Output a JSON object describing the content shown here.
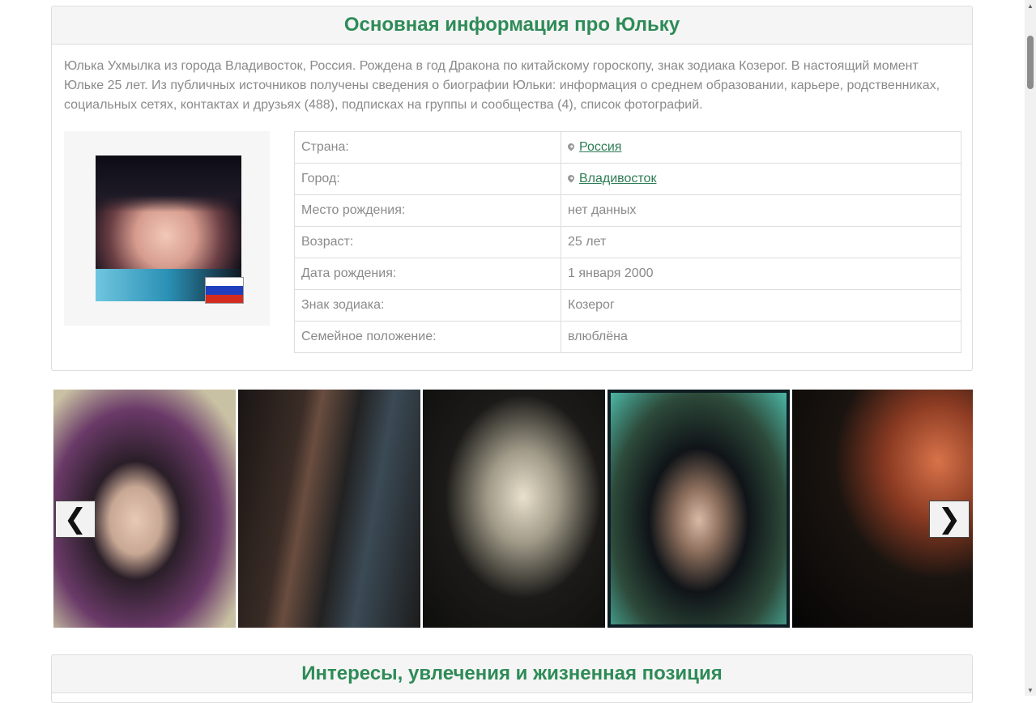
{
  "main_panel": {
    "title": "Основная информация про Юльку",
    "intro": "Юлька Ухмылка из города Владивосток, Россия. Рождена в год Дракона по китайскому гороскопу, знак зодиака Козерог. В настоящий момент Юльке 25 лет. Из публичных источников получены сведения о биографии Юльки: информация о среднем образовании, карьере, родственниках, социальных сетях, контактах и друзьях (488), подписках на группы и сообщества (4), список фотографий.",
    "info_rows": [
      {
        "label": "Страна:",
        "value": "Россия",
        "link": true
      },
      {
        "label": "Город:",
        "value": "Владивосток",
        "link": true
      },
      {
        "label": "Место рождения:",
        "value": "нет данных"
      },
      {
        "label": "Возраст:",
        "value": "25 лет"
      },
      {
        "label": "Дата рождения:",
        "value": "1 января 2000"
      },
      {
        "label": "Знак зодиака:",
        "value": "Козерог"
      },
      {
        "label": "Семейное положение:",
        "value": "влюблёна"
      }
    ]
  },
  "gallery": {
    "prev_icon": "chevron-left-icon",
    "next_icon": "chevron-right-icon",
    "prev_glyph": "❮",
    "next_glyph": "❯"
  },
  "interests_panel": {
    "title": "Интересы, увлечения и жизненная позиция"
  },
  "colors": {
    "accent": "#2e8b57",
    "link": "#2e7d55",
    "text": "#8a8a8a",
    "border": "#dddddd"
  }
}
